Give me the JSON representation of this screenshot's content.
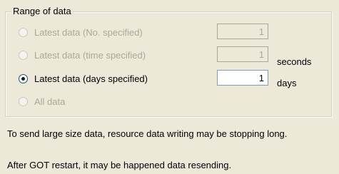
{
  "group": {
    "title": "Range of data"
  },
  "options": [
    {
      "label": "Latest data (No. specified)",
      "enabled": false,
      "selected": false
    },
    {
      "label": "Latest data (time specified)",
      "enabled": false,
      "selected": false
    },
    {
      "label": "Latest data (days specified)",
      "enabled": true,
      "selected": true
    },
    {
      "label": "All data",
      "enabled": false,
      "selected": false
    }
  ],
  "fields": {
    "count": {
      "value": "1",
      "enabled": false
    },
    "time": {
      "value": "1",
      "enabled": false,
      "unit": "seconds"
    },
    "days": {
      "value": "1",
      "enabled": true,
      "unit": "days"
    }
  },
  "notes": [
    "To send large size data, resource data writing may be stopping long.",
    "After GOT restart, it may be happened data resending."
  ],
  "colors": {
    "background": "#ece9d8",
    "disabled_text": "#aca899",
    "input_border": "#7f9db9"
  }
}
